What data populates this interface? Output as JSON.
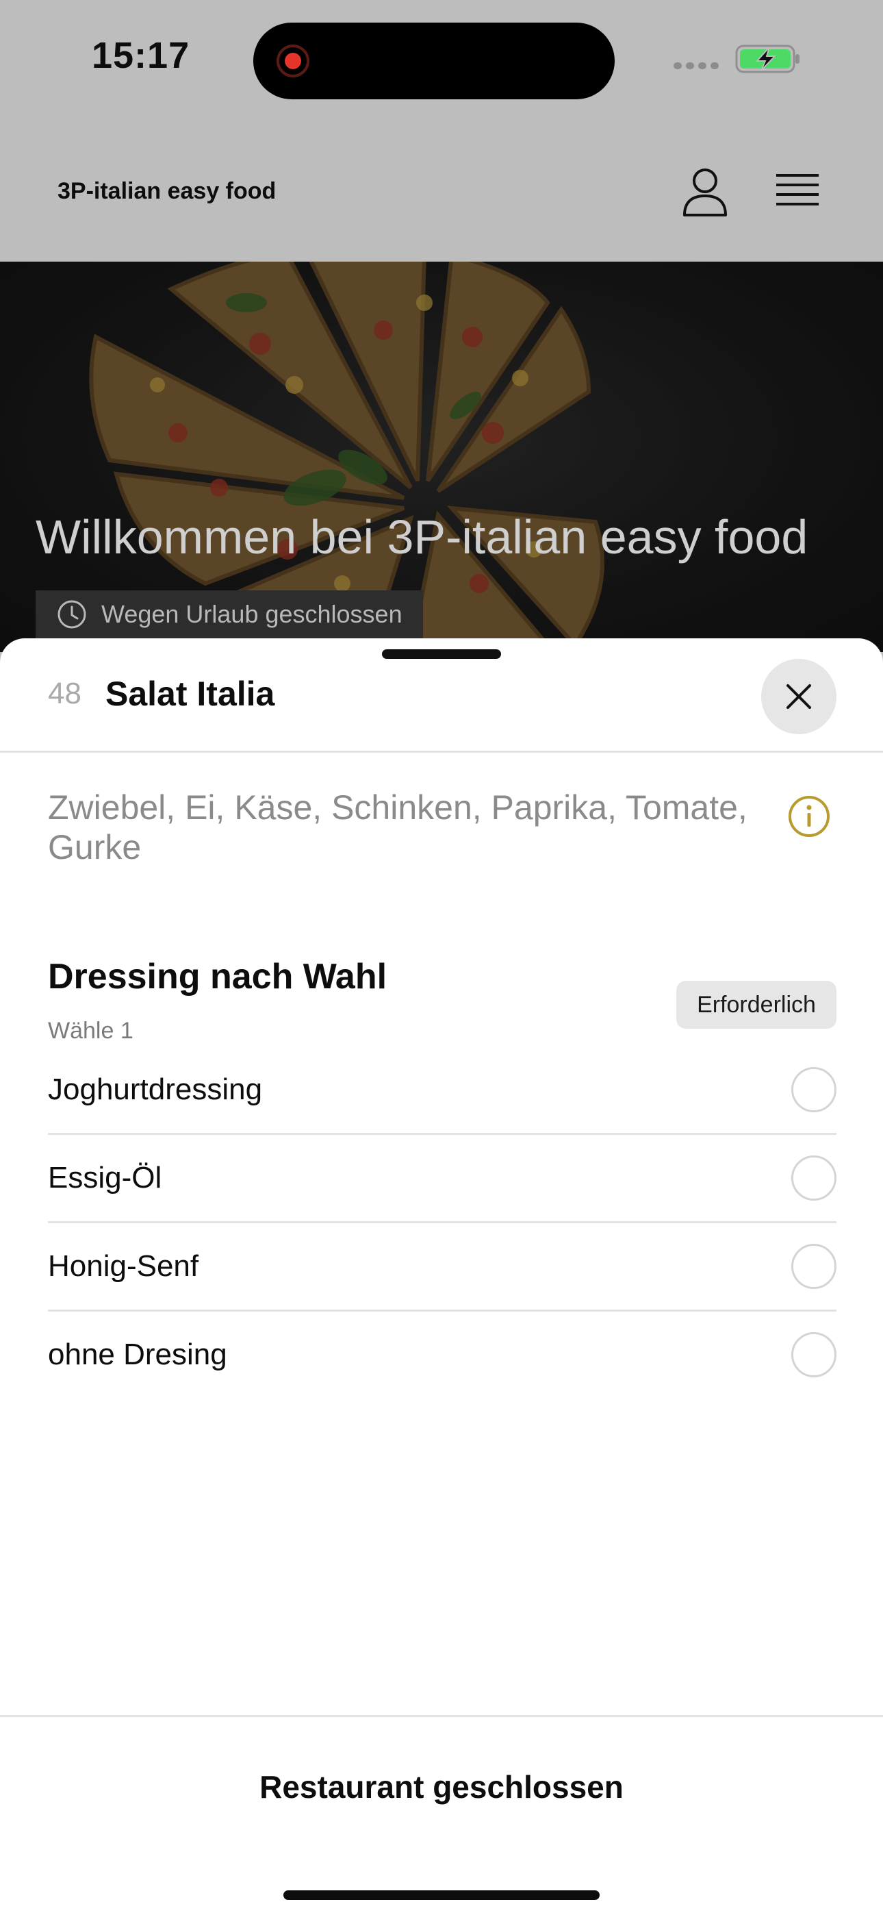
{
  "status_bar": {
    "time": "15:17",
    "recording_color": "#e5352b",
    "battery_color": "#4cd964"
  },
  "header": {
    "app_name": "3P-italian easy food",
    "user_icon": "user-icon",
    "menu_icon": "hamburger-menu-icon"
  },
  "hero": {
    "title": "Willkommen bei 3P-italian easy food",
    "status_icon": "clock-icon",
    "status_text": "Wegen Urlaub geschlossen"
  },
  "sheet": {
    "item_number": "48",
    "item_title": "Salat Italia",
    "close_icon": "close-icon",
    "description": "Zwiebel, Ei, Käse, Schinken, Paprika, Tomate, Gurke",
    "info_icon": "info-icon",
    "info_color": "#b89a2e",
    "option_group": {
      "title": "Dressing nach Wahl",
      "subtitle": "Wähle 1",
      "badge": "Erforderlich",
      "options": [
        {
          "label": "Joghurtdressing",
          "selected": false
        },
        {
          "label": "Essig-Öl",
          "selected": false
        },
        {
          "label": "Honig-Senf",
          "selected": false
        },
        {
          "label": "ohne Dresing",
          "selected": false
        }
      ]
    },
    "footer_status": "Restaurant geschlossen"
  }
}
